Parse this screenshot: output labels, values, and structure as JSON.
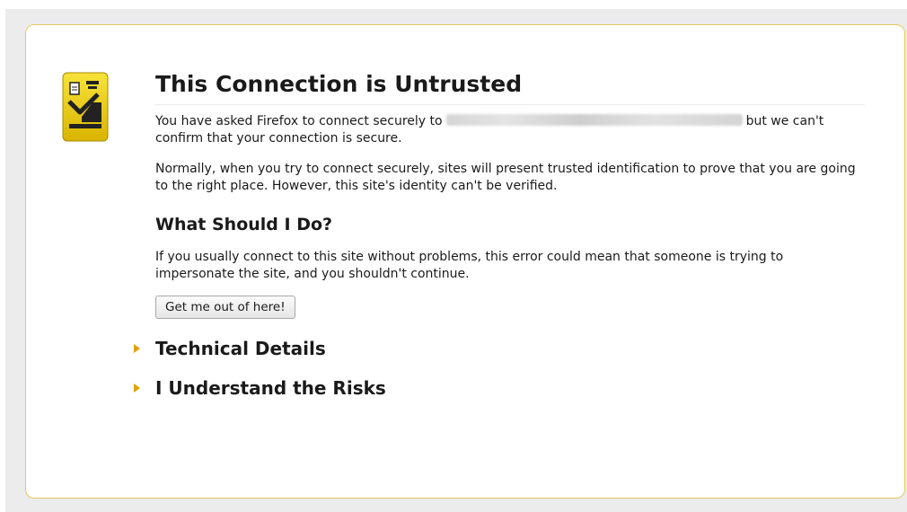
{
  "page": {
    "title": "This Connection is Untrusted",
    "intro_before": "You have asked Firefox to connect securely to",
    "intro_after": "but we can't confirm that your connection is secure.",
    "normally": "Normally, when you try to connect securely, sites will present trusted identification to prove that you are going to the right place. However, this site's identity can't be verified.",
    "what_heading": "What Should I Do?",
    "what_text": "If you usually connect to this site without problems, this error could mean that someone is trying to impersonate the site, and you shouldn't continue.",
    "get_out_label": "Get me out of here!",
    "technical_details_label": "Technical Details",
    "understand_risks_label": "I Understand the Risks"
  },
  "icons": {
    "certificate": "passport-control-officer-icon",
    "expander": "triangle-right-icon"
  },
  "colors": {
    "box_border": "#e8c95e",
    "icon_yellow": "#f2d400",
    "expander_arrow": "#e2a100",
    "page_background": "#ececec"
  }
}
